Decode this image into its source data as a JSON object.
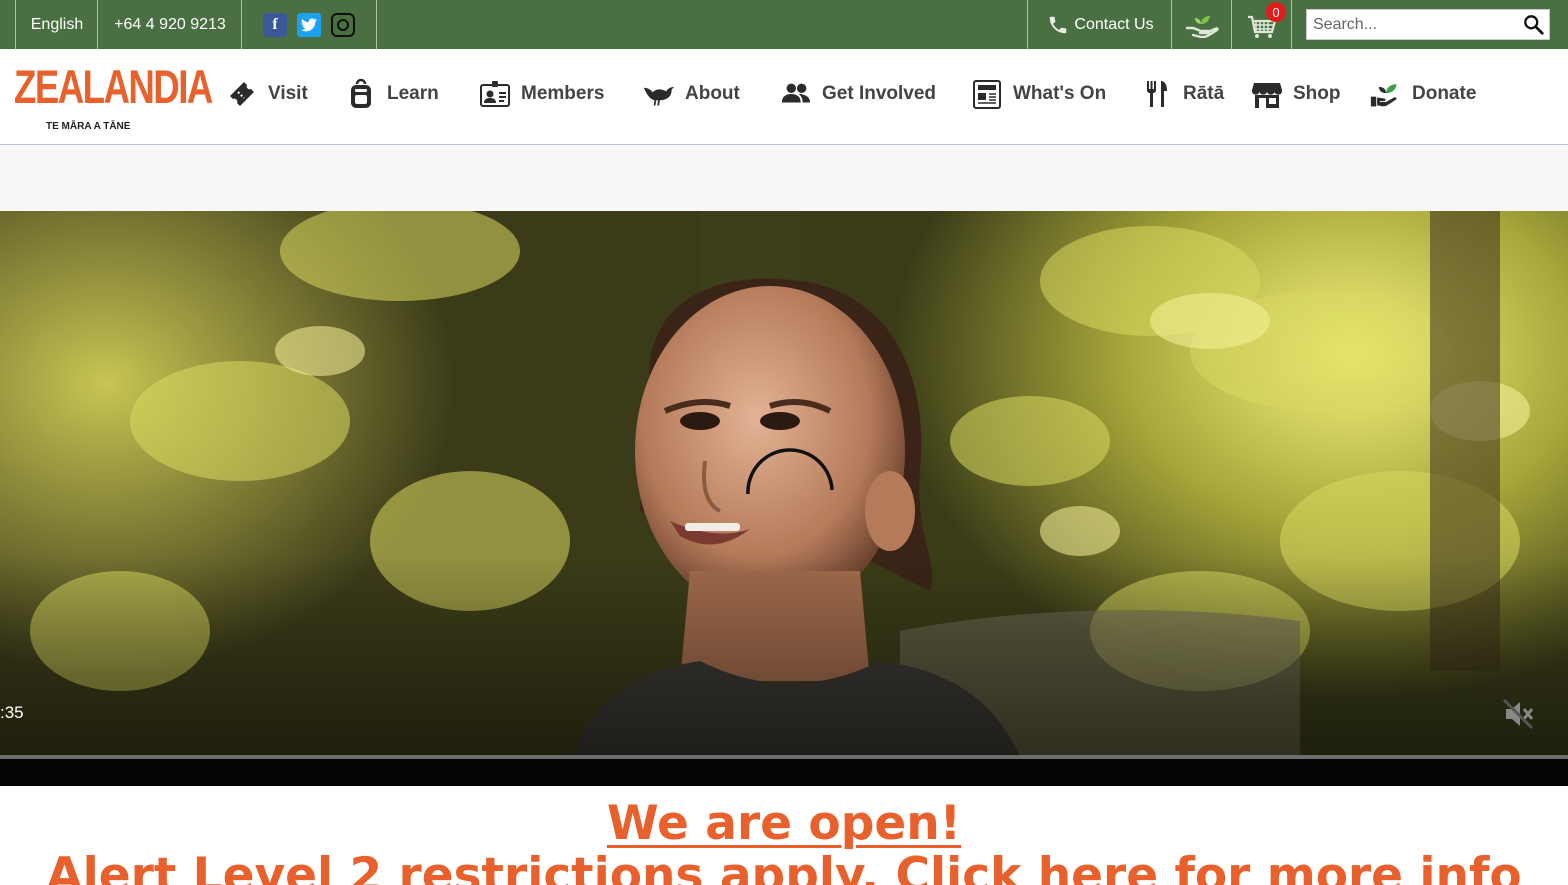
{
  "topbar": {
    "language": "English",
    "phone": "+64 4 920 9213",
    "social": [
      "facebook-icon",
      "twitter-icon",
      "instagram-icon"
    ],
    "contact_label": "Contact Us",
    "cart_count": "0",
    "search_placeholder": "Search..."
  },
  "brand": {
    "name": "ZEALANDIA",
    "tagline": "TE MĀRA A TĀNE",
    "color": "#e8612c"
  },
  "nav": {
    "items": [
      {
        "label": "Visit",
        "icon": "ticket-icon"
      },
      {
        "label": "Learn",
        "icon": "backpack-icon"
      },
      {
        "label": "Members",
        "icon": "member-card-icon"
      },
      {
        "label": "About",
        "icon": "bird-icon"
      },
      {
        "label": "Get Involved",
        "icon": "people-icon"
      },
      {
        "label": "What's On",
        "icon": "newspaper-icon"
      },
      {
        "label": "Rātā",
        "icon": "cutlery-icon"
      },
      {
        "label": "Shop",
        "icon": "store-icon"
      },
      {
        "label": "Donate",
        "icon": "donate-hand-icon"
      }
    ]
  },
  "video": {
    "time": ":35",
    "muted": true
  },
  "notice": {
    "line1": "We are open!",
    "line2": "Alert Level 2 restrictions apply. Click here for more info"
  },
  "colors": {
    "topbar": "#4a6f42",
    "accent": "#e8612c"
  }
}
